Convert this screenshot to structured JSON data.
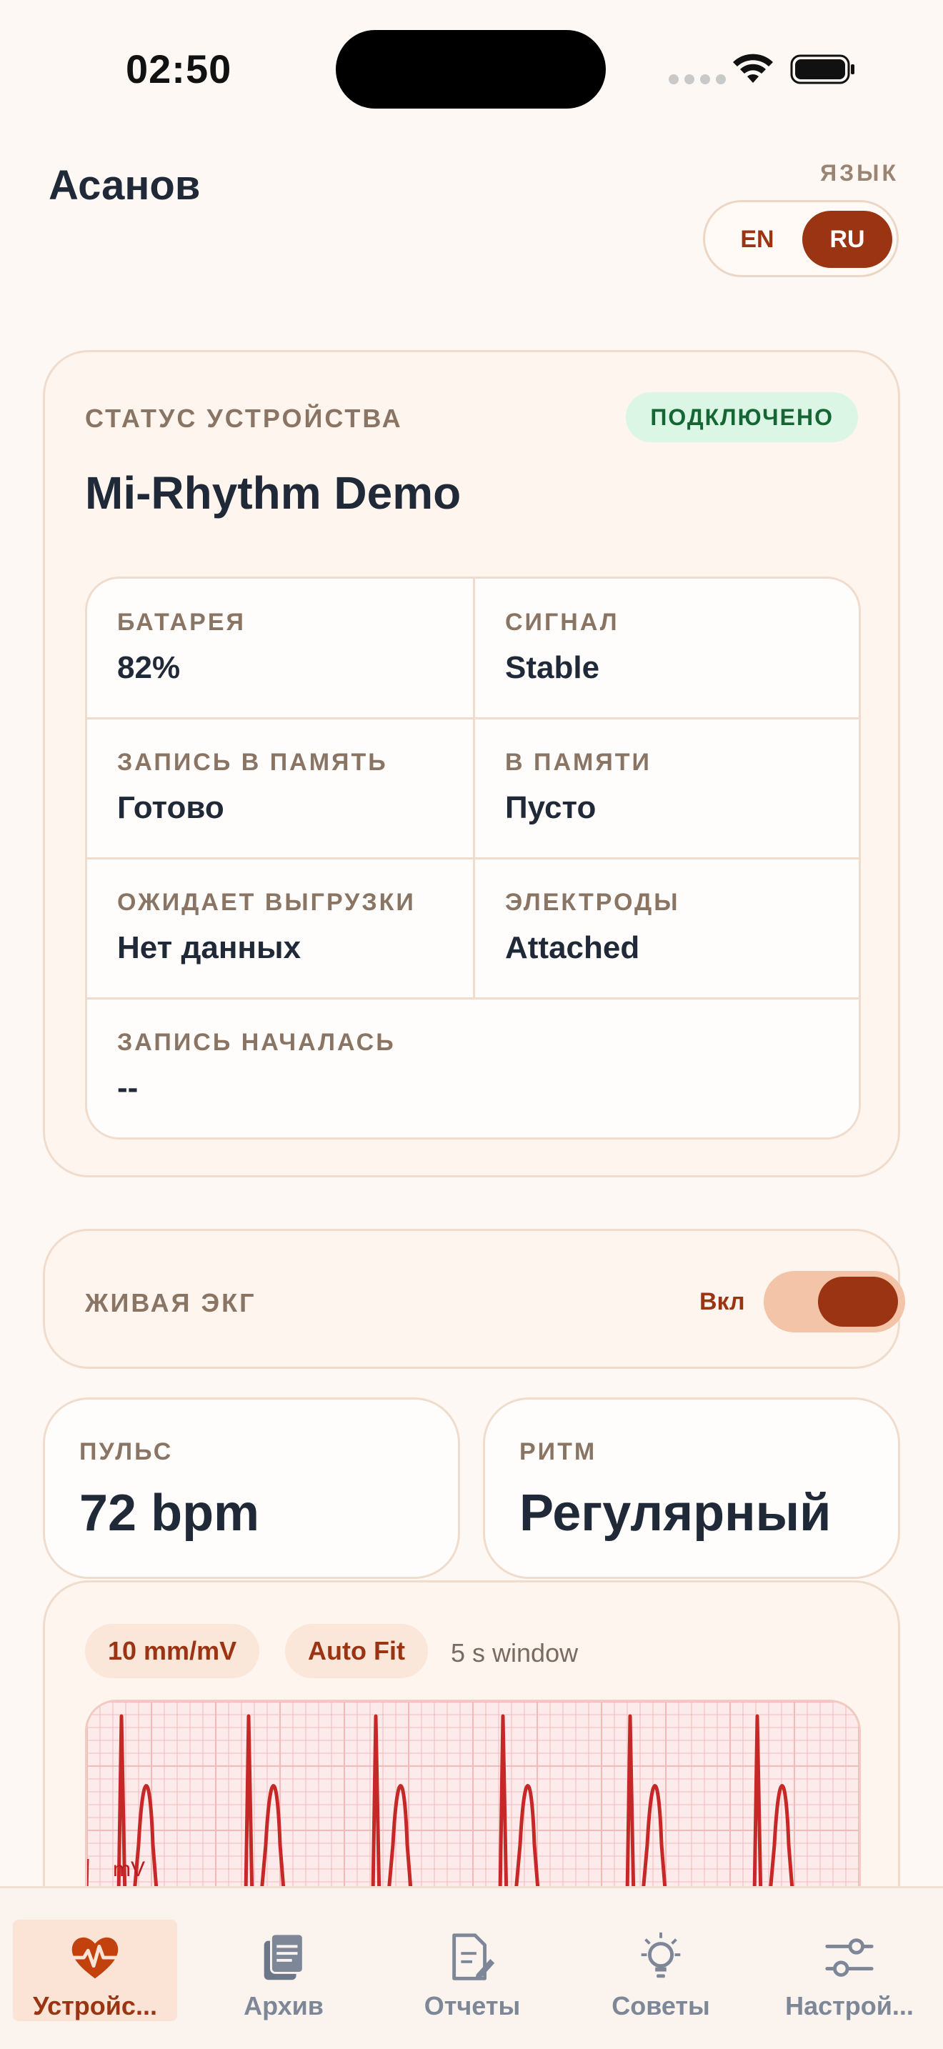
{
  "status_bar": {
    "time": "02:50"
  },
  "header": {
    "user_name": "Асанов",
    "language_label": "ЯЗЫК",
    "languages": [
      "EN",
      "RU"
    ],
    "selected_language": "RU"
  },
  "device": {
    "section_label": "СТАТУС УСТРОЙСТВА",
    "connection_badge": "ПОДКЛЮЧЕНО",
    "name": "Mi-Rhythm Demo",
    "fields": [
      {
        "label": "БАТАРЕЯ",
        "value": "82%"
      },
      {
        "label": "СИГНАЛ",
        "value": "Stable"
      },
      {
        "label": "ЗАПИСЬ В ПАМЯТЬ",
        "value": "Готово"
      },
      {
        "label": "В ПАМЯТИ",
        "value": "Пусто"
      },
      {
        "label": "ОЖИДАЕТ ВЫГРУЗКИ",
        "value": "Нет данных"
      },
      {
        "label": "ЭЛЕКТРОДЫ",
        "value": "Attached"
      },
      {
        "label": "ЗАПИСЬ НАЧАЛАСЬ",
        "value": "--"
      }
    ]
  },
  "live_ecg": {
    "label": "ЖИВАЯ ЭКГ",
    "state_text": "Вкл",
    "enabled": true
  },
  "metrics": {
    "pulse": {
      "label": "ПУЛЬС",
      "value": "72 bpm"
    },
    "rhythm": {
      "label": "РИТМ",
      "value": "Регулярный"
    }
  },
  "ecg_chart": {
    "scale_chip": "10 mm/mV",
    "fit_chip": "Auto Fit",
    "window_text": "5 s window",
    "unit_label": "mV",
    "trace_color": "#c62828",
    "grid_color": "#f4b9b9"
  },
  "tabs": [
    {
      "label": "Устройс...",
      "icon": "heart-pulse-icon",
      "active": true
    },
    {
      "label": "Архив",
      "icon": "document-icon",
      "active": false
    },
    {
      "label": "Отчеты",
      "icon": "report-edit-icon",
      "active": false
    },
    {
      "label": "Советы",
      "icon": "lightbulb-icon",
      "active": false
    },
    {
      "label": "Настрой...",
      "icon": "sliders-icon",
      "active": false
    }
  ],
  "colors": {
    "accent": "#9a3412",
    "background": "#fdf8f4",
    "success": "#166534"
  }
}
